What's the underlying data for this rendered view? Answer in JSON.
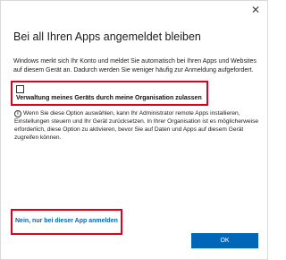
{
  "dialog": {
    "close_glyph": "✕",
    "title": "Bei all Ihren Apps angemeldet bleiben",
    "intro": "Windows merkt sich Ihr Konto und meldet Sie automatisch bei Ihren Apps und Websites auf diesem Gerät an. Dadurch werden Sie weniger häufig zur Anmeldung aufgefordert.",
    "manage_device": {
      "checked": false,
      "label": "Verwaltung meines Geräts durch meine Organisation zulassen"
    },
    "info_icon_glyph": "i",
    "info_text": "Wenn Sie diese Option auswählen, kann Ihr Administrator remote Apps installieren, Einstellungen steuern und Ihr Gerät zurücksetzen. In Ihrer Organisation ist es möglicherweise erforderlich, diese Option zu aktivieren, bevor Sie auf Daten und Apps auf diesem Gerät zugreifen können.",
    "app_only_link": "Nein, nur bei dieser App anmelden",
    "ok_label": "OK"
  },
  "colors": {
    "accent": "#0067b8",
    "highlight_border": "#e0001b"
  }
}
